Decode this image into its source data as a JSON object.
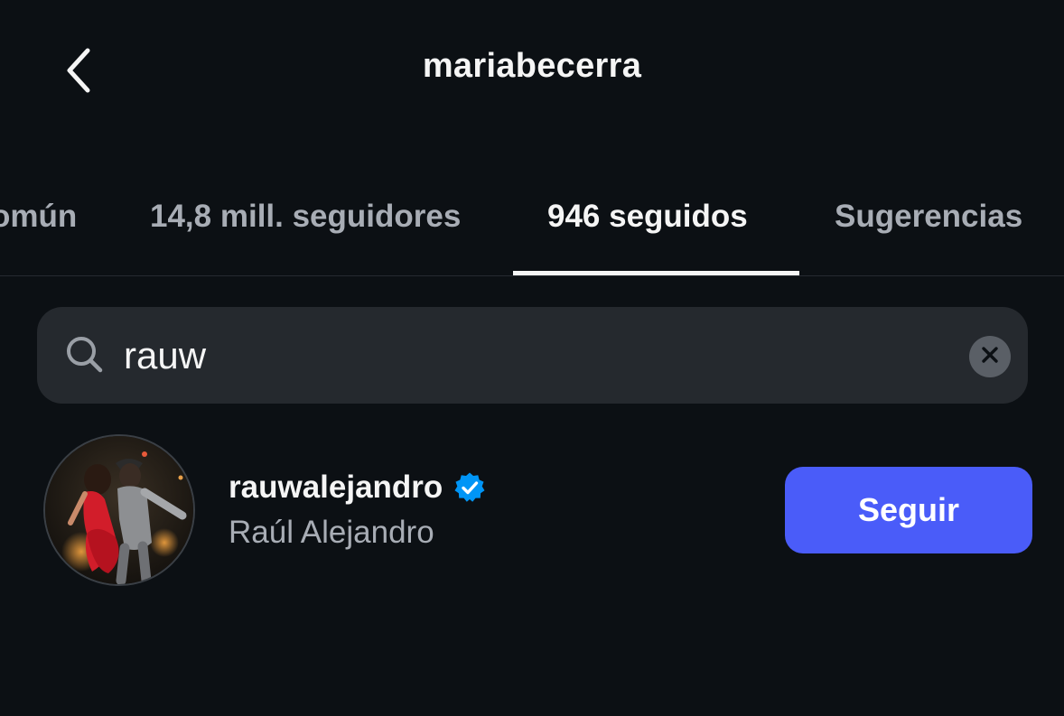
{
  "header": {
    "title": "mariabecerra",
    "back_icon": "chevron-left-icon"
  },
  "tabs": [
    {
      "label": "omún",
      "active": false
    },
    {
      "label": "14,8 mill. seguidores",
      "active": false
    },
    {
      "label": "946 seguidos",
      "active": true
    },
    {
      "label": "Sugerencias",
      "active": false
    }
  ],
  "search": {
    "value": "rauw",
    "icon": "search-icon",
    "clear_icon": "clear-icon"
  },
  "results": [
    {
      "username": "rauwalejandro",
      "verified": true,
      "full_name": "Raúl Alejandro",
      "button_label": "Seguir"
    }
  ],
  "colors": {
    "background": "#0c1014",
    "follow_button": "#4a5cf9",
    "verified_badge": "#0095f6",
    "secondary_text": "#a8adb5"
  }
}
